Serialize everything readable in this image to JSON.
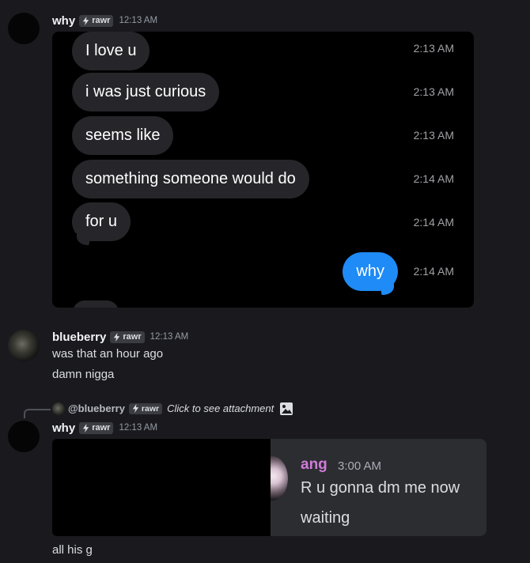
{
  "messages": [
    {
      "author": "why",
      "tag": "rawr",
      "time": "12:13 AM"
    },
    {
      "author": "blueberry",
      "tag": "rawr",
      "time": "12:13 AM",
      "lines": [
        "was that an hour ago",
        "damn nigga"
      ]
    },
    {
      "author": "why",
      "tag": "rawr",
      "time": "12:13 AM",
      "reply": {
        "mention": "@blueberry",
        "tag": "rawr",
        "text": "Click to see attachment"
      },
      "text": "all his g"
    }
  ],
  "screenshot": {
    "bubbles": [
      {
        "text": "I love u",
        "time": "2:13 AM"
      },
      {
        "text": "i was just curious",
        "time": "2:13 AM"
      },
      {
        "text": "seems like",
        "time": "2:13 AM"
      },
      {
        "text": "something someone would do",
        "time": "2:14 AM"
      },
      {
        "text": "for u",
        "time": "2:14 AM"
      },
      {
        "text": "why",
        "time": "2:14 AM"
      }
    ]
  },
  "embed_card": {
    "name": "ang",
    "time": "3:00 AM",
    "lines": [
      "R u gonna dm me now",
      "waiting"
    ],
    "name_color": "#d07bd9"
  },
  "colors": {
    "background": "#1a1a1e",
    "imessage_blue": "#1e8bf6",
    "imessage_gray": "#26252a"
  },
  "icons": [
    "lightning-icon",
    "image-icon"
  ]
}
